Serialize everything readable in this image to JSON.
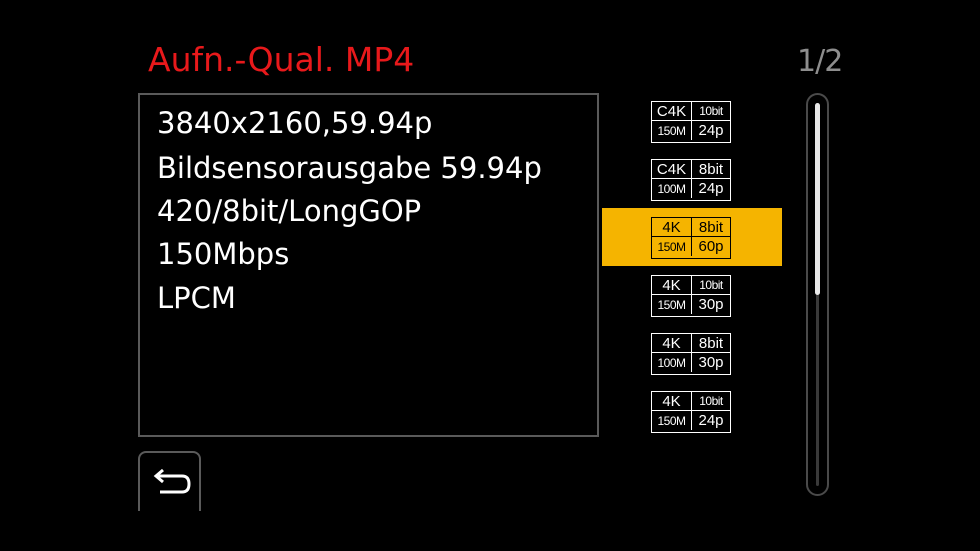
{
  "header": {
    "title": "Aufn.-Qual. MP4",
    "page_indicator": "1/2"
  },
  "details": {
    "lines": [
      "3840x2160,59.94p",
      "Bildsensorausgabe 59.94p",
      "420/8bit/LongGOP",
      "150Mbps",
      "LPCM"
    ]
  },
  "options": [
    {
      "resolution": "C4K",
      "bit_depth": "10bit",
      "bitrate": "150M",
      "frame_rate": "24p",
      "selected": false
    },
    {
      "resolution": "C4K",
      "bit_depth": "8bit",
      "bitrate": "100M",
      "frame_rate": "24p",
      "selected": false
    },
    {
      "resolution": "4K",
      "bit_depth": "8bit",
      "bitrate": "150M",
      "frame_rate": "60p",
      "selected": true
    },
    {
      "resolution": "4K",
      "bit_depth": "10bit",
      "bitrate": "150M",
      "frame_rate": "30p",
      "selected": false
    },
    {
      "resolution": "4K",
      "bit_depth": "8bit",
      "bitrate": "100M",
      "frame_rate": "30p",
      "selected": false
    },
    {
      "resolution": "4K",
      "bit_depth": "10bit",
      "bitrate": "150M",
      "frame_rate": "24p",
      "selected": false
    }
  ],
  "scrollbar": {
    "position_fraction": 0.0,
    "visible_fraction": 0.5
  },
  "icons": {
    "back": "return-arrow-icon"
  },
  "colors": {
    "background": "#000000",
    "title": "#e8191b",
    "selection": "#f5b400",
    "text": "#ffffff",
    "page_indicator": "#8e8e8e",
    "border": "#5a5a5a"
  }
}
